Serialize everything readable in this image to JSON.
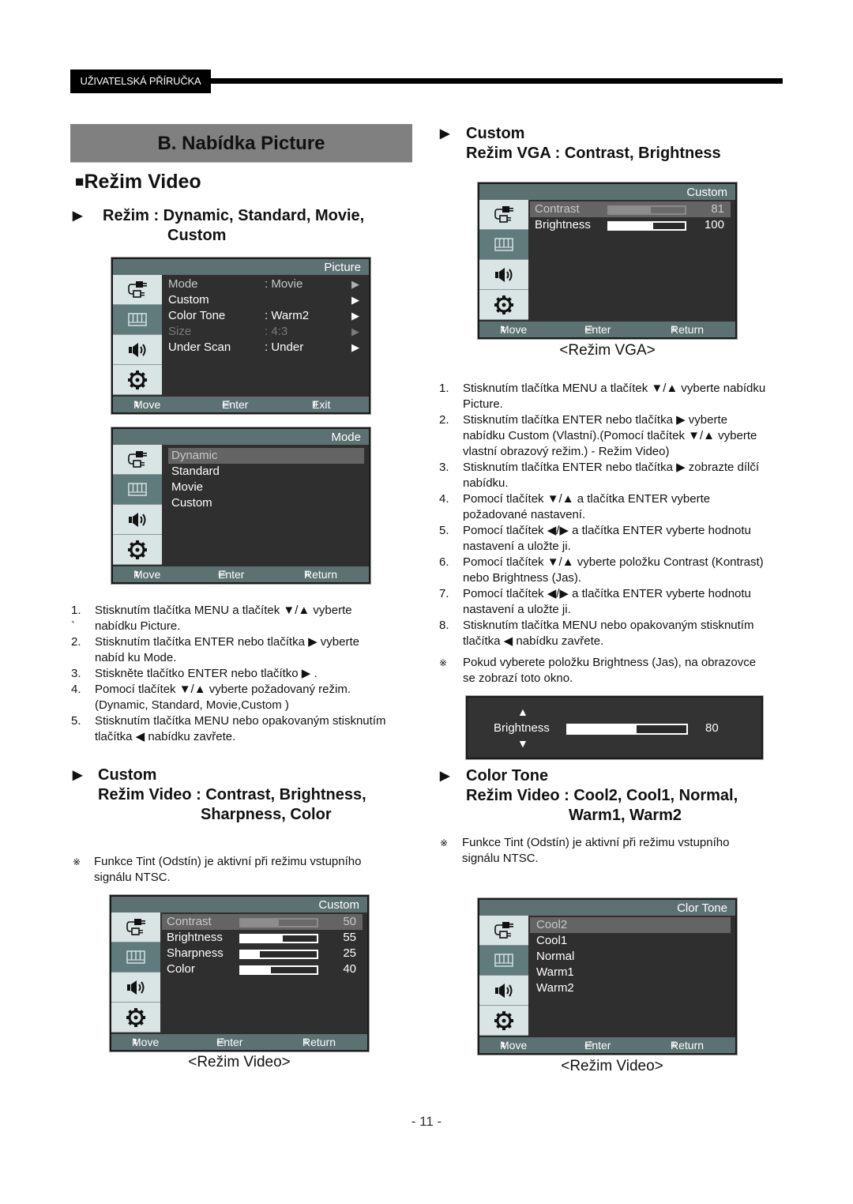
{
  "header": {
    "label": "UŽIVATELSKÁ PŘÍRUČKA"
  },
  "section_title": "B. Nabídka Picture",
  "subsection": {
    "bullet": "■",
    "title": "Režim Video"
  },
  "left": {
    "mode_heading": {
      "line1": "Režim  : Dynamic, Standard, Movie,",
      "line2": "Custom"
    },
    "osd_picture": {
      "title": "Picture",
      "items": [
        {
          "label": "Mode",
          "value": ": Movie",
          "state": "selected-dim"
        },
        {
          "label": "Custom",
          "value": "",
          "state": "normal"
        },
        {
          "label": "Color Tone",
          "value": ": Warm2",
          "state": "normal"
        },
        {
          "label": "Size",
          "value": ": 4:3",
          "state": "disabled"
        },
        {
          "label": "Under Scan",
          "value": ": Under",
          "state": "normal"
        }
      ],
      "footer": {
        "move": "Move",
        "enter": "Enter",
        "back": "Exit"
      }
    },
    "osd_mode": {
      "title": "Mode",
      "items": [
        "Dynamic",
        "Standard",
        "Movie",
        "Custom"
      ],
      "selected_index": 0,
      "footer": {
        "move": "Move",
        "enter": "Enter",
        "back": "Return"
      }
    },
    "steps": [
      {
        "num": "1.",
        "text": "Stisknutím tlačítka MENU a tlačítek ▼/▲ vyberte"
      },
      {
        "num": "`",
        "text": "nabídku Picture."
      },
      {
        "num": "2.",
        "text": "Stisknutím tlačítka ENTER nebo tlačítka ▶ vyberte"
      },
      {
        "num": "",
        "text": "nabíd ku Mode."
      },
      {
        "num": "3.",
        "text": "Stiskněte tlačítko ENTER nebo tlačítko ▶ ."
      },
      {
        "num": "4.",
        "text": "Pomocí tlačítek ▼/▲ vyberte požadovaný režim."
      },
      {
        "num": "",
        "text": "(Dynamic, Standard, Movie,Custom )"
      },
      {
        "num": "5.",
        "text": "Stisknutím tlačítka MENU nebo opakovaným stisknutím"
      },
      {
        "num": "",
        "text": "tlačítka ◀ nabídku zavřete."
      }
    ],
    "custom_heading": {
      "line1": "Custom",
      "line2": "Režim Video : Contrast, Brightness,",
      "line3": "Sharpness, Color"
    },
    "note": {
      "mark": "※",
      "line1": "Funkce Tint (Odstín) je aktivní při režimu vstupního",
      "line2": "signálu NTSC."
    },
    "osd_custom": {
      "title": "Custom",
      "items": [
        {
          "label": "Contrast",
          "value": "50",
          "level_percent": 50
        },
        {
          "label": "Brightness",
          "value": "55",
          "level_percent": 55
        },
        {
          "label": "Sharpness",
          "value": "25",
          "level_percent": 25
        },
        {
          "label": "Color",
          "value": "40",
          "level_percent": 40
        }
      ],
      "selected_index": 0,
      "footer": {
        "move": "Move",
        "enter": "Enter",
        "back": "Return"
      }
    },
    "caption": "<Režim Video>"
  },
  "right": {
    "custom_heading": {
      "line1": "Custom",
      "line2": "Režim VGA : Contrast, Brightness"
    },
    "osd_vga": {
      "title": "Custom",
      "items": [
        {
          "label": "Contrast",
          "value": "81",
          "level_percent": 55
        },
        {
          "label": "Brightness",
          "value": "100",
          "level_percent": 58
        }
      ],
      "selected_index": 0,
      "footer": {
        "move": "Move",
        "enter": "Enter",
        "back": "Return"
      }
    },
    "vga_caption": "<Režim VGA>",
    "steps": [
      {
        "num": "1.",
        "text": "Stisknutím tlačítka MENU a tlačítek ▼/▲ vyberte nabídku"
      },
      {
        "num": "",
        "text": "Picture."
      },
      {
        "num": "2.",
        "text": "Stisknutím tlačítka ENTER nebo tlačítka ▶ vyberte"
      },
      {
        "num": "",
        "text": "nabídku Custom (Vlastní).(Pomocí tlačítek ▼/▲ vyberte"
      },
      {
        "num": "",
        "text": "vlastní obrazový režim.) - Režim Video)"
      },
      {
        "num": "3.",
        "text": "Stisknutím tlačítka ENTER nebo tlačítka ▶ zobrazte dílčí"
      },
      {
        "num": "",
        "text": "nabídku."
      },
      {
        "num": "4.",
        "text": "Pomocí tlačítek ▼/▲ a tlačítka ENTER vyberte"
      },
      {
        "num": "",
        "text": "požadované nastavení."
      },
      {
        "num": "5.",
        "text": "Pomocí tlačítek ◀/▶ a tlačítka ENTER vyberte hodnotu"
      },
      {
        "num": "",
        "text": "nastavení a uložte ji."
      },
      {
        "num": "6.",
        "text": "Pomocí tlačítek ▼/▲ vyberte položku Contrast (Kontrast)"
      },
      {
        "num": "",
        "text": "nebo Brightness (Jas)."
      },
      {
        "num": "7.",
        "text": "Pomocí tlačítek ◀/▶ a tlačítka ENTER vyberte hodnotu"
      },
      {
        "num": "",
        "text": "nastavení a uložte ji."
      },
      {
        "num": "8.",
        "text": "Stisknutím tlačítka MENU nebo opakovaným stisknutím"
      },
      {
        "num": "",
        "text": "tlačítka ◀ nabídku zavřete."
      }
    ],
    "brightness_note": {
      "mark": "※",
      "line1": "Pokud vyberete položku Brightness (Jas), na obrazovce",
      "line2": "se zobrazí toto okno."
    },
    "brightness_popup": {
      "label": "Brightness",
      "value": "80",
      "level_percent": 58
    },
    "colortone_heading": {
      "line1": "Color Tone",
      "line2": "Režim Video : Cool2, Cool1, Normal,",
      "line3": "Warm1, Warm2"
    },
    "note": {
      "mark": "※",
      "line1": "Funkce Tint (Odstín) je aktivní při režimu vstupního",
      "line2": "signálu NTSC."
    },
    "osd_colortone": {
      "title": "Clor Tone",
      "items": [
        "Cool2",
        "Cool1",
        "Normal",
        "Warm1",
        "Warm2"
      ],
      "selected_index": 0,
      "footer": {
        "move": "Move",
        "enter": "Enter",
        "back": "Return"
      }
    },
    "caption": "<Režim Video>"
  },
  "page_number": "- 11 -",
  "colors": {
    "osd_bar": "#5c7272",
    "osd_body": "#2f2f2f",
    "osd_tile": "#d9e4e4",
    "osd_tile_active": "#5f7b7b",
    "banner": "#808080"
  }
}
